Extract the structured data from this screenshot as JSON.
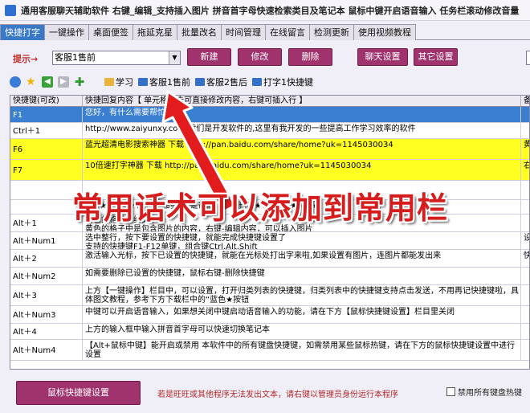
{
  "marquee": {
    "text": "通用客服聊天辅助软件  右键_编辑_支持插入图片  拼音首字母快速检索类目及笔记本  鼠标中键开启语音输入  任务栏滚动修改音量"
  },
  "tabs": [
    "快捷打字",
    "一键操作",
    "桌面便签",
    "拖延克星",
    "批量改名",
    "时间管理",
    "在线留言",
    "检测更新",
    "使用视频教程"
  ],
  "toolbar": {
    "prompt_label": "提示→",
    "select_value": "客服1售前",
    "buttons": [
      "新建",
      "修改",
      "删除",
      "聊天设置",
      "其它设置"
    ]
  },
  "categories": [
    "学习",
    "客服1售前",
    "客服2售后",
    "打字1快捷键"
  ],
  "table": {
    "headers": [
      "快捷键(可改)",
      "快捷回复内容【  单元格双击可直接修改内容，右键可插入行  】",
      "备"
    ],
    "rows": [
      {
        "key": "F1",
        "content": "您好，有什么需要帮忙的么？",
        "extra": ""
      },
      {
        "key": "Ctrl＋1",
        "content": "http://www.zaiyunxy.com  我们是开发软件的,这里有我开发的一些提高工作学习效率的软件",
        "extra": ""
      },
      {
        "key": "F6",
        "content": "蓝光超清电影搜索神器  下载  http://pan.baidu.com/share/home?uk=1145030034",
        "extra": "黄"
      },
      {
        "key": "F7",
        "content": "10倍速打字神器  下载  http://pan.baidu.com/share/home?uk=1145030034",
        "extra": "右"
      },
      {
        "key": "",
        "content": "",
        "extra": ""
      },
      {
        "key": "",
        "content": "★★★★★★★★★下面的内容是帮助，可以删除★★★★★★★★★",
        "extra": ""
      },
      {
        "key": "Alt＋1",
        "content": "白色的格子是纯文本\n黄色的格子中是包含图片的内容，右键-编辑内容，可以插入图片",
        "extra": ""
      },
      {
        "key": "Alt＋Num1",
        "content": "选中整行，按下要设置的快捷键，就能完成快捷键设置了\n支持的快捷键F1-F12单键，组合键Ctrl,Alt,Shift",
        "extra": "设"
      },
      {
        "key": "Alt＋2",
        "content": "激活输入光标，按下已设置的快捷键，就能在光标处打出字来啦,如果设置有图片，连图片都能发出来",
        "extra": "快"
      },
      {
        "key": "Alt＋Num2",
        "content": "如需要删除已设置的快捷键，鼠标右键-删除快捷键",
        "extra": ""
      },
      {
        "key": "Alt＋3",
        "content": "上方【一键操作】栏目中，可以设置，打开归类列表的快捷键，归类列表中的快捷键支持点击发送，不用再记快捷键啦，具体图文教程，参考下方下载栏中的“蓝色★按钮",
        "extra": ""
      },
      {
        "key": "Alt＋Num3",
        "content": "中键可以开启语音输入，如果想关闭中键启动语音输入的功能，请在下方【鼠标快捷键设置】栏目里关闭",
        "extra": ""
      },
      {
        "key": "Alt＋4",
        "content": "上方的输入框中输入拼音首字母可以快速切换笔记本",
        "extra": ""
      },
      {
        "key": "Alt＋Num4",
        "content": "【Alt+鼠标中键】能开启或禁用 本软件中的所有键盘快捷键，如需禁用某些鼠标热键，请在下方的鼠标快捷键设置中进行设置",
        "extra": ""
      }
    ]
  },
  "overlay": {
    "caption": "常用话术可以添加到常用栏"
  },
  "bottom": {
    "mouse_button": "鼠标快捷键设置",
    "note": "若是旺旺或其他程序无法发出文本，请右键以管理员身份运行本程序",
    "checkbox_label": "禁用所有键盘热键"
  },
  "colors": {
    "accent_button": "#a0326d",
    "selected_row": "#3a7fd0",
    "image_row": "#ffff22",
    "caption_red": "#d51d1d"
  }
}
